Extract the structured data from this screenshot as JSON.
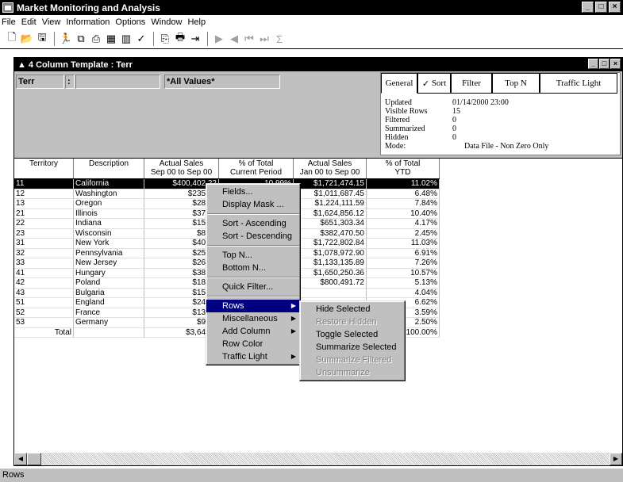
{
  "app": {
    "title": "Market Monitoring and Analysis",
    "min": "_",
    "max": "□",
    "close": "×"
  },
  "menu": [
    "File",
    "Edit",
    "View",
    "Information",
    "Options",
    "Window",
    "Help"
  ],
  "toolbar": [
    "new-icon",
    "open-icon",
    "save-icon",
    "run-icon",
    "tree-icon",
    "print-preview-icon",
    "table-icon",
    "bar-chart-icon",
    "check-icon",
    "copy-icon",
    "print-icon",
    "export-icon",
    "play-icon",
    "first-icon",
    "prev-icon",
    "next-icon",
    "sum-icon"
  ],
  "child": {
    "title": "4 Column Template : Terr"
  },
  "filter": {
    "field": "Terr",
    "sep": ":",
    "value": "",
    "all_values": "*All Values*"
  },
  "tabs": [
    "General",
    "Sort",
    "Filter",
    "Top N",
    "Traffic Light"
  ],
  "info": [
    {
      "k": "Updated",
      "v": "01/14/2000 23:00"
    },
    {
      "k": "Visible Rows",
      "v": "15"
    },
    {
      "k": "Filtered",
      "v": "0"
    },
    {
      "k": "Summarized",
      "v": "0"
    },
    {
      "k": "Hidden",
      "v": "0"
    },
    {
      "k": "Mode:",
      "v": "Data File - Non Zero Only"
    }
  ],
  "columns": [
    [
      "Territory",
      ""
    ],
    [
      "Description",
      ""
    ],
    [
      "Actual Sales",
      "Sep 00 to Sep 00"
    ],
    [
      "% of Total",
      "Current Period"
    ],
    [
      "Actual Sales",
      "Jan 00 to Sep 00"
    ],
    [
      "% of Total",
      "YTD"
    ]
  ],
  "rows": [
    [
      "11",
      "California",
      "$400,402.22",
      "10.99%",
      "$1,721,474.15",
      "11.02%"
    ],
    [
      "12",
      "Washington",
      "$235,18",
      "",
      "$1,011,687.45",
      "6.48%"
    ],
    [
      "13",
      "Oregon",
      "$285,0",
      "",
      "$1,224,111.59",
      "7.84%"
    ],
    [
      "21",
      "Illinois",
      "$378,0",
      "",
      "$1,624,856.12",
      "10.40%"
    ],
    [
      "22",
      "Indiana",
      "$151,4",
      "",
      "$651,303.34",
      "4.17%"
    ],
    [
      "23",
      "Wisconsin",
      "$88,9",
      "",
      "$382,470.50",
      "2.45%"
    ],
    [
      "31",
      "New York",
      "$400,6",
      "",
      "$1,722,802.84",
      "11.03%"
    ],
    [
      "32",
      "Pennsylvania",
      "$250,8",
      "",
      "$1,078,972.90",
      "6.91%"
    ],
    [
      "33",
      "New Jersey",
      "$265,6",
      "",
      "$1,133,135.89",
      "7.26%"
    ],
    [
      "41",
      "Hungary",
      "$385,0",
      "",
      "$1,650,250.36",
      "10.57%"
    ],
    [
      "42",
      "Poland",
      "$187,5",
      "",
      "$800,491.72",
      "5.13%"
    ],
    [
      "43",
      "Bulgaria",
      "$151,7",
      "",
      "",
      "4.04%"
    ],
    [
      "51",
      "England",
      "$240,2",
      "",
      "",
      "6.62%"
    ],
    [
      "52",
      "France",
      "$130,3",
      "",
      "",
      "3.59%"
    ],
    [
      "53",
      "Germany",
      "$93,1",
      "",
      "",
      "2.50%"
    ],
    [
      "Total",
      "",
      "$3,644,1",
      "",
      "",
      "100.00%"
    ]
  ],
  "ctx1": [
    {
      "label": "Fields...",
      "u": 0
    },
    {
      "label": "Display Mask ...",
      "u": 8
    },
    {
      "sep": true
    },
    {
      "label": "Sort - Ascending",
      "u": 7
    },
    {
      "label": "Sort - Descending",
      "u": 7
    },
    {
      "sep": true
    },
    {
      "label": "Top N...",
      "u": 0
    },
    {
      "label": "Bottom N...",
      "u": 0
    },
    {
      "sep": true
    },
    {
      "label": "Quick Filter...",
      "u": 0
    },
    {
      "sep": true
    },
    {
      "label": "Rows",
      "arrow": true,
      "hi": true
    },
    {
      "label": "Miscellaneous",
      "arrow": true
    },
    {
      "label": "Add Column",
      "arrow": true
    },
    {
      "label": "Row Color"
    },
    {
      "label": "Traffic Light",
      "arrow": true
    }
  ],
  "ctx2": [
    {
      "label": "Hide Selected"
    },
    {
      "label": "Restore Hidden",
      "dis": true
    },
    {
      "label": "Toggle Selected"
    },
    {
      "label": "Summarize Selected"
    },
    {
      "label": "Summarize Filtered",
      "dis": true
    },
    {
      "label": "Unsummarize",
      "dis": true
    }
  ],
  "status": "Rows"
}
